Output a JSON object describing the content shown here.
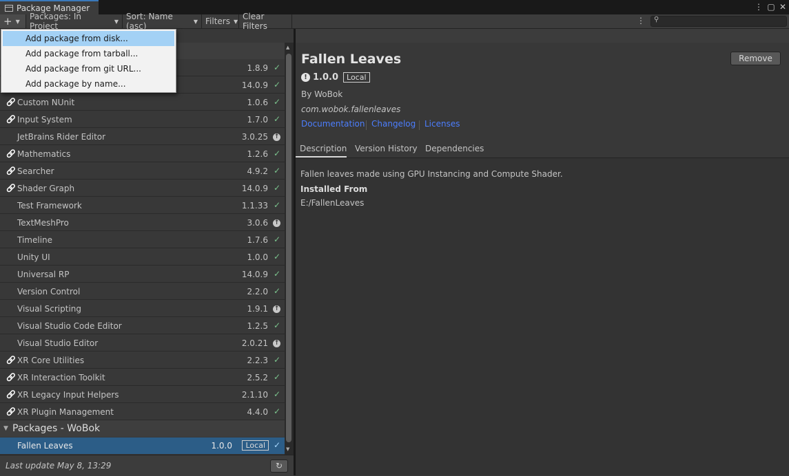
{
  "window": {
    "tab_title": "Package Manager"
  },
  "toolbar": {
    "add_label": "+",
    "packages_filter": "Packages: In Project",
    "sort": "Sort: Name (asc)",
    "filters": "Filters",
    "clear_filters": "Clear Filters",
    "search_placeholder": ""
  },
  "add_menu": {
    "items": [
      "Add package from disk...",
      "Add package from tarball...",
      "Add package from git URL...",
      "Add package by name..."
    ],
    "highlighted_index": 0
  },
  "package_list": {
    "rows": [
      {
        "name": "",
        "version": "1.8.9",
        "status": "installed",
        "linked": false
      },
      {
        "name": "",
        "version": "14.0.9",
        "status": "installed",
        "linked": false
      },
      {
        "name": "Custom NUnit",
        "version": "1.0.6",
        "status": "installed",
        "linked": true
      },
      {
        "name": "Input System",
        "version": "1.7.0",
        "status": "installed",
        "linked": true
      },
      {
        "name": "JetBrains Rider Editor",
        "version": "3.0.25",
        "status": "update",
        "linked": false
      },
      {
        "name": "Mathematics",
        "version": "1.2.6",
        "status": "installed",
        "linked": true
      },
      {
        "name": "Searcher",
        "version": "4.9.2",
        "status": "installed",
        "linked": true
      },
      {
        "name": "Shader Graph",
        "version": "14.0.9",
        "status": "installed",
        "linked": true
      },
      {
        "name": "Test Framework",
        "version": "1.1.33",
        "status": "installed",
        "linked": false
      },
      {
        "name": "TextMeshPro",
        "version": "3.0.6",
        "status": "update",
        "linked": false
      },
      {
        "name": "Timeline",
        "version": "1.7.6",
        "status": "installed",
        "linked": false
      },
      {
        "name": "Unity UI",
        "version": "1.0.0",
        "status": "installed",
        "linked": false
      },
      {
        "name": "Universal RP",
        "version": "14.0.9",
        "status": "installed",
        "linked": false
      },
      {
        "name": "Version Control",
        "version": "2.2.0",
        "status": "installed",
        "linked": false
      },
      {
        "name": "Visual Scripting",
        "version": "1.9.1",
        "status": "update",
        "linked": false
      },
      {
        "name": "Visual Studio Code Editor",
        "version": "1.2.5",
        "status": "installed",
        "linked": false
      },
      {
        "name": "Visual Studio Editor",
        "version": "2.0.21",
        "status": "update",
        "linked": false
      },
      {
        "name": "XR Core Utilities",
        "version": "2.2.3",
        "status": "installed",
        "linked": true
      },
      {
        "name": "XR Interaction Toolkit",
        "version": "2.5.2",
        "status": "installed",
        "linked": true
      },
      {
        "name": "XR Legacy Input Helpers",
        "version": "2.1.10",
        "status": "installed",
        "linked": true
      },
      {
        "name": "XR Plugin Management",
        "version": "4.4.0",
        "status": "installed",
        "linked": true
      }
    ],
    "group_wobok": "Packages - WoBok",
    "selected": {
      "name": "Fallen Leaves",
      "version": "1.0.0",
      "badge": "Local"
    }
  },
  "footer": {
    "last_update": "Last update May 8, 13:29"
  },
  "detail": {
    "title": "Fallen Leaves",
    "remove_label": "Remove",
    "version": "1.0.0",
    "badge": "Local",
    "author": "By WoBok",
    "package_id": "com.wobok.fallenleaves",
    "links": [
      "Documentation",
      "Changelog",
      "Licenses"
    ],
    "tabs": [
      "Description",
      "Version History",
      "Dependencies"
    ],
    "description": "Fallen leaves made using GPU Instancing and Compute Shader.",
    "installed_from_label": "Installed From",
    "installed_from_path": "E:/FallenLeaves"
  }
}
